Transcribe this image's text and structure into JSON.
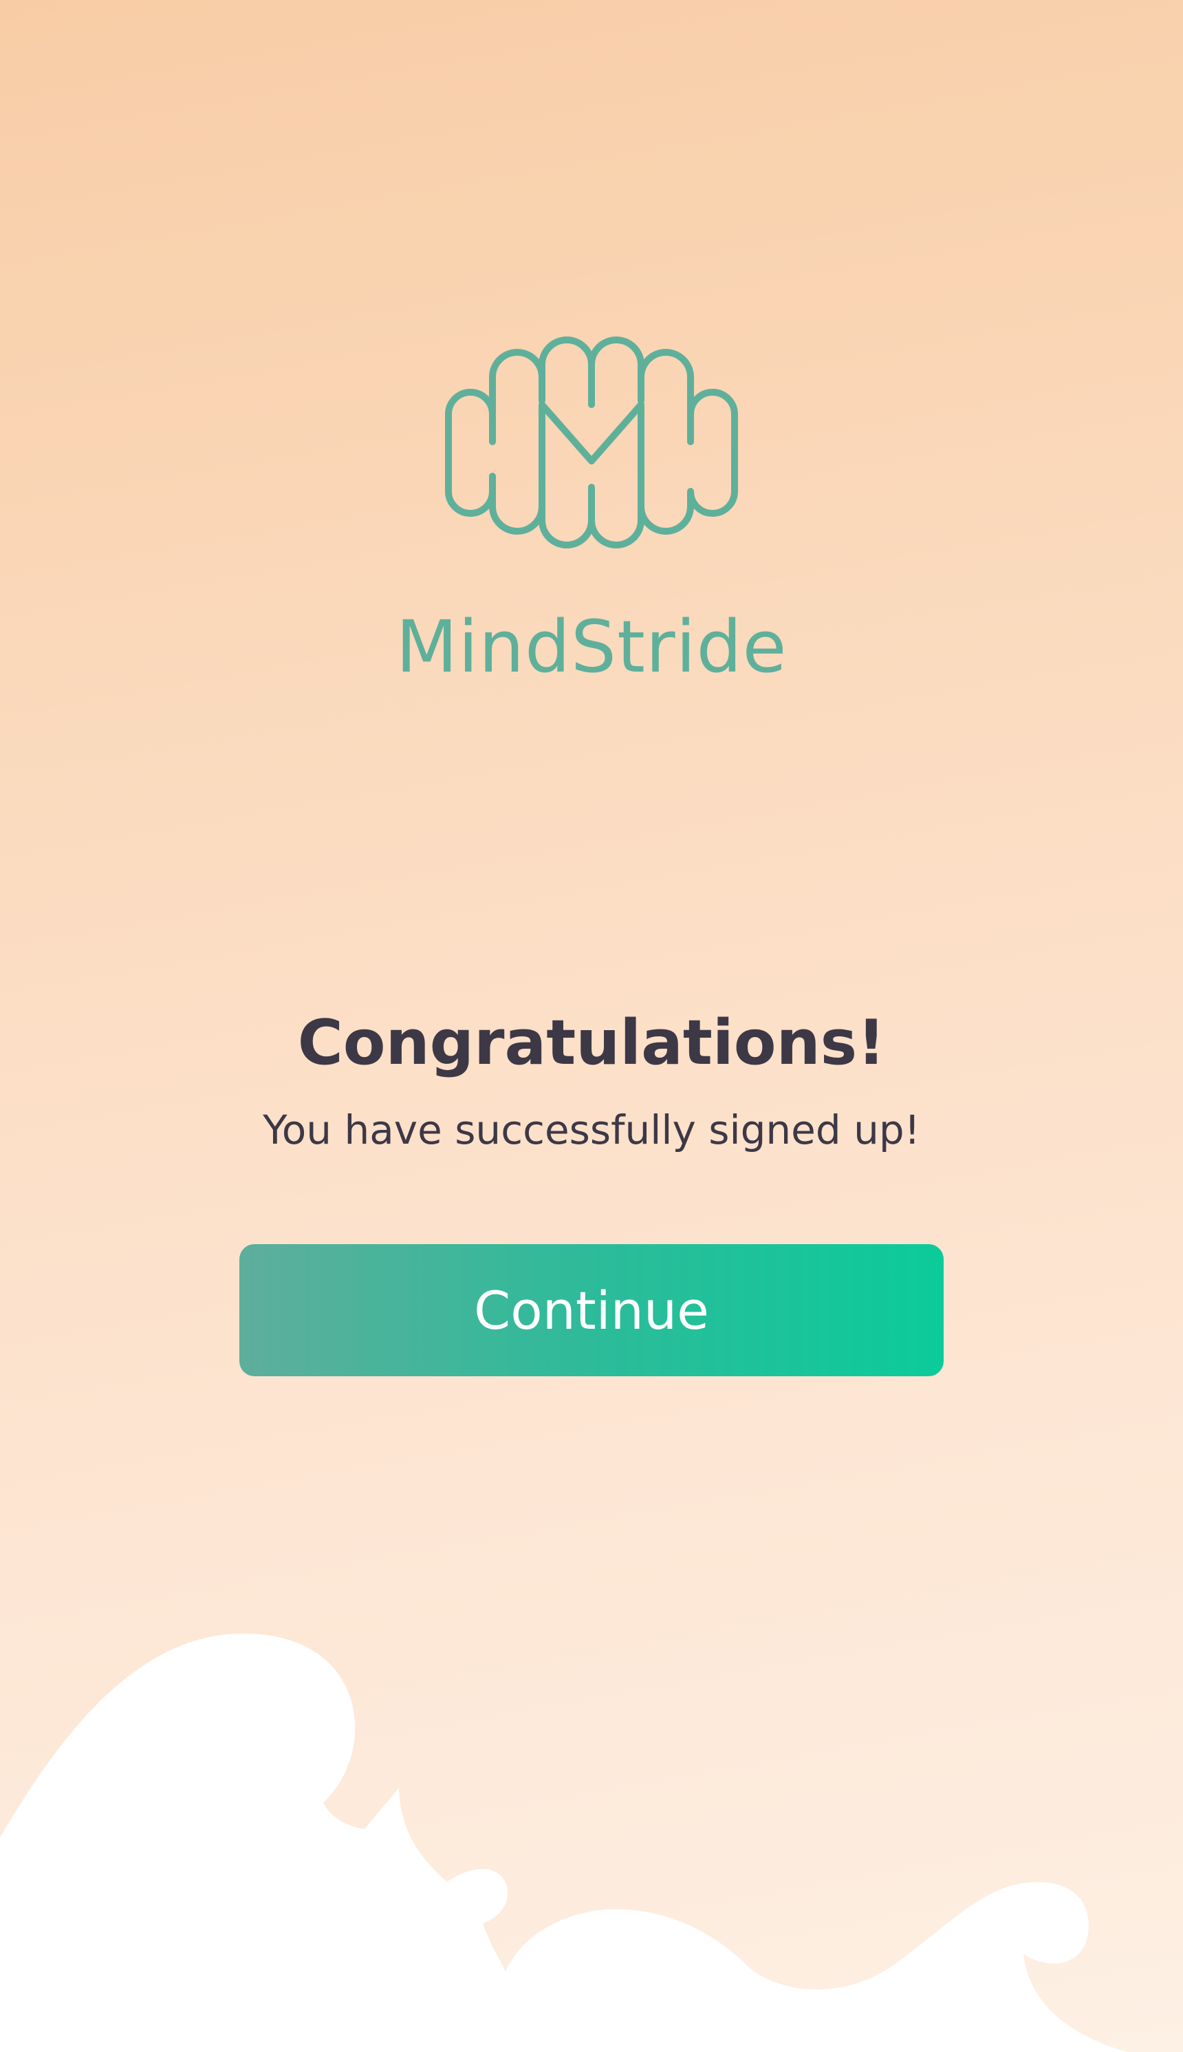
{
  "brand": {
    "name": "MindStride",
    "logo_icon": "brain-m-logo-icon",
    "color": "#5fb09b"
  },
  "message": {
    "headline": "Congratulations!",
    "subline": "You have successfully signed up!"
  },
  "actions": {
    "continue_label": "Continue"
  },
  "colors": {
    "background_top": "#f8cda6",
    "background_bottom": "#fdf0e4",
    "button_start": "#5eae9c",
    "button_end": "#0ccb9b",
    "text_dark": "#3d3846"
  }
}
